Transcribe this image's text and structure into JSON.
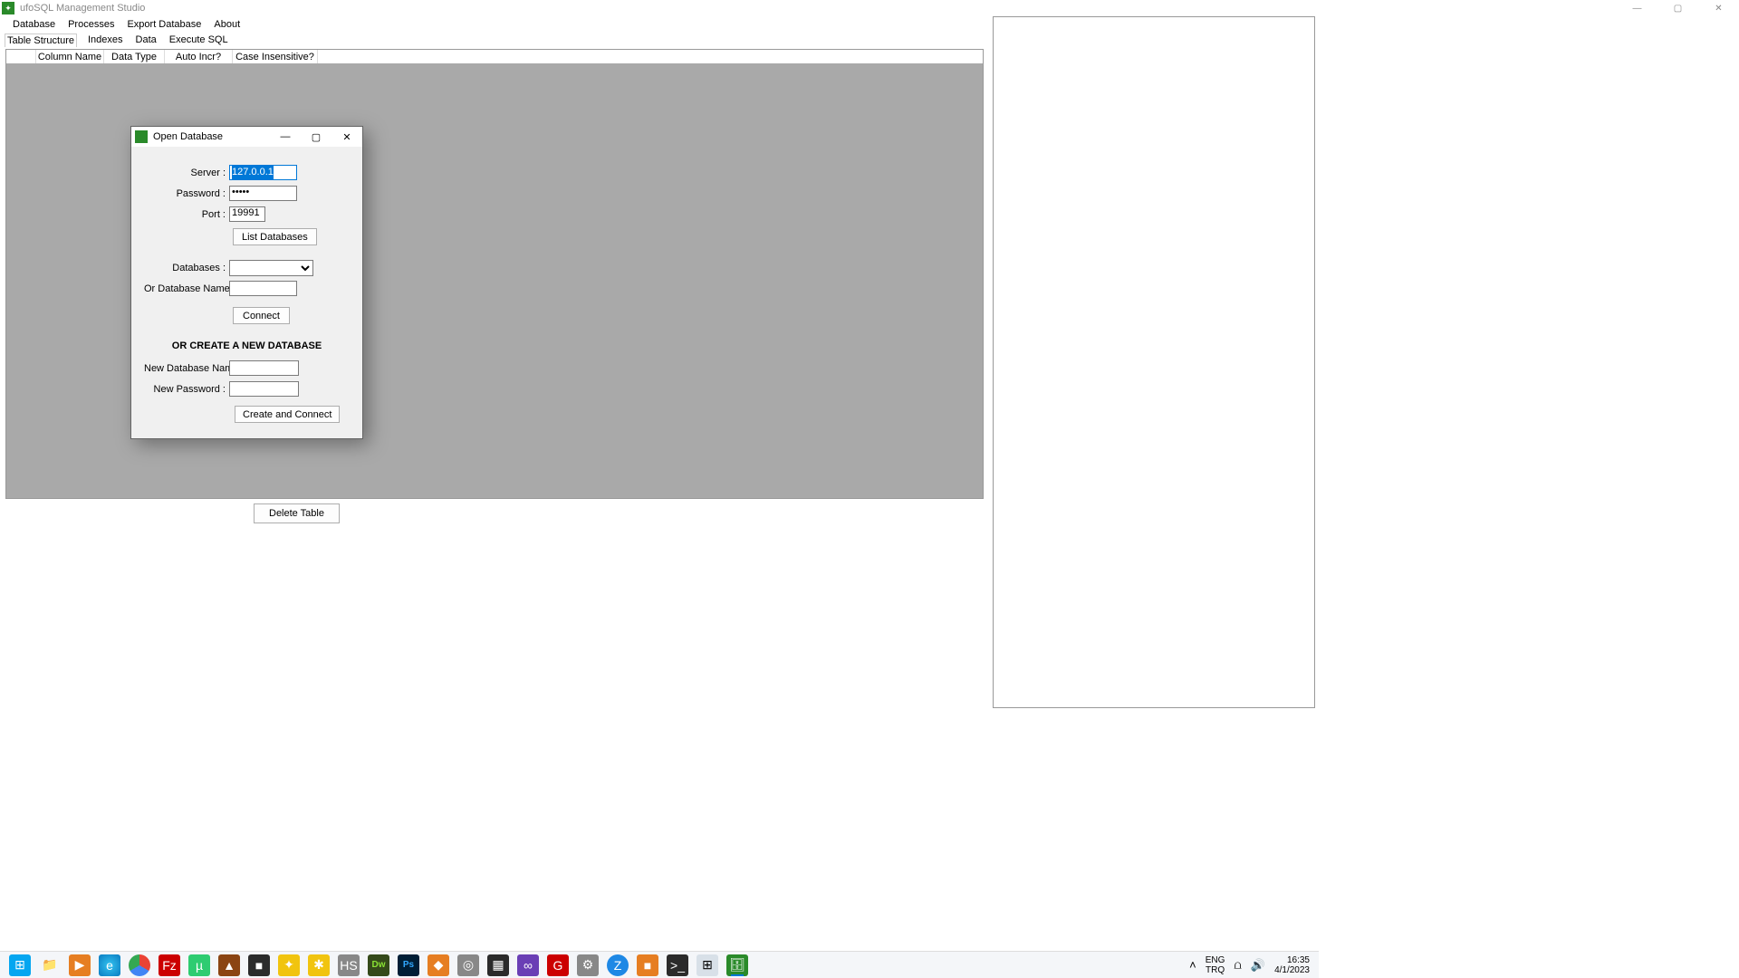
{
  "window": {
    "title": "ufoSQL Management Studio",
    "controls": {
      "min": "—",
      "max": "▢",
      "close": "✕"
    }
  },
  "menu": {
    "database": "Database",
    "processes": "Processes",
    "export": "Export Database",
    "about": "About"
  },
  "tabs": {
    "structure": "Table Structure",
    "indexes": "Indexes",
    "data": "Data",
    "execute": "Execute SQL"
  },
  "table_header": {
    "col_name": "Column Name",
    "data_type": "Data Type",
    "auto_incr": "Auto Incr?",
    "case_ins": "Case Insensitive?"
  },
  "delete_table": "Delete Table",
  "dialog": {
    "title": "Open Database",
    "server_label": "Server :",
    "server_value": "127.0.0.1",
    "password_label": "Password :",
    "password_value": "•••••",
    "port_label": "Port :",
    "port_value": "19991",
    "list_db_btn": "List Databases",
    "databases_label": "Databases :",
    "or_dbname_label": "Or Database Name :",
    "connect_btn": "Connect",
    "or_create_heading": "OR CREATE A NEW DATABASE",
    "new_dbname_label": "New Database Name :",
    "new_password_label": "New Password :",
    "create_btn": "Create and Connect",
    "min": "—",
    "max": "▢",
    "close": "✕"
  },
  "tray": {
    "lang1": "ENG",
    "lang2": "TRQ",
    "time": "16:35",
    "date": "4/1/2023",
    "chevron": "˄",
    "wifi": "⩍",
    "vol": "🔊"
  },
  "taskbar_icons": [
    {
      "name": "start",
      "glyph": "⊞",
      "cls": "bg-win"
    },
    {
      "name": "explorer",
      "glyph": "📁",
      "cls": ""
    },
    {
      "name": "media",
      "glyph": "▶",
      "cls": "bg-orange"
    },
    {
      "name": "edge",
      "glyph": "e",
      "cls": "bg-edge"
    },
    {
      "name": "chrome",
      "glyph": "",
      "cls": "bg-chrome"
    },
    {
      "name": "filezilla",
      "glyph": "Fz",
      "cls": "bg-red"
    },
    {
      "name": "utorrent",
      "glyph": "µ",
      "cls": "bg-lu"
    },
    {
      "name": "app8",
      "glyph": "▲",
      "cls": "bg-brown"
    },
    {
      "name": "app9",
      "glyph": "■",
      "cls": "bg-dark"
    },
    {
      "name": "app10",
      "glyph": "✦",
      "cls": "bg-yellow"
    },
    {
      "name": "app11",
      "glyph": "✱",
      "cls": "bg-yellow"
    },
    {
      "name": "heidisql",
      "glyph": "HS",
      "cls": "bg-gray"
    },
    {
      "name": "dreamweaver",
      "glyph": "Dw",
      "cls": "bg-dw"
    },
    {
      "name": "photoshop",
      "glyph": "Ps",
      "cls": "bg-ps"
    },
    {
      "name": "app15",
      "glyph": "◆",
      "cls": "bg-orange"
    },
    {
      "name": "app16",
      "glyph": "◎",
      "cls": "bg-gray"
    },
    {
      "name": "app17",
      "glyph": "▦",
      "cls": "bg-dark"
    },
    {
      "name": "visualstudio",
      "glyph": "∞",
      "cls": "bg-purple"
    },
    {
      "name": "app19",
      "glyph": "G",
      "cls": "bg-red"
    },
    {
      "name": "app20",
      "glyph": "⚙",
      "cls": "bg-gray"
    },
    {
      "name": "app21",
      "glyph": "Z",
      "cls": "bg-z"
    },
    {
      "name": "app22",
      "glyph": "■",
      "cls": "bg-orange"
    },
    {
      "name": "terminal",
      "glyph": ">_",
      "cls": "bg-dark"
    },
    {
      "name": "calculator",
      "glyph": "⊞",
      "cls": "bg-calc"
    },
    {
      "name": "ufosql",
      "glyph": "🗄",
      "cls": "bg-green",
      "active": true
    }
  ]
}
